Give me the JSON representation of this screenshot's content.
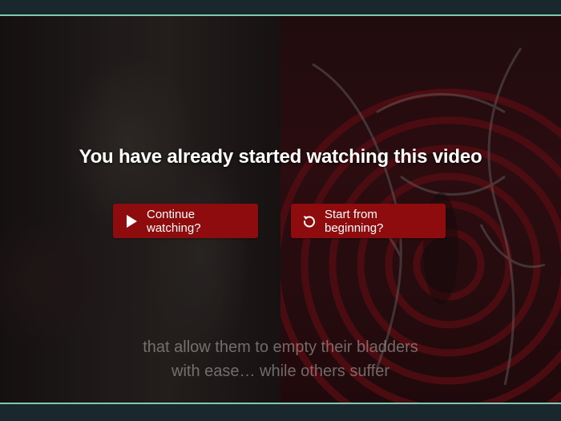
{
  "overlay": {
    "title": "You have already started watching this video"
  },
  "buttons": {
    "continue_label": "Continue watching?",
    "continue_icon": "play-icon",
    "restart_label": "Start from beginning?",
    "restart_icon": "restart-icon"
  },
  "captions": {
    "line1": "that allow them to empty their bladders",
    "line2": "with ease… while others suffer"
  },
  "colors": {
    "button_bg": "#8e0c0d",
    "accent_rule": "#7fc9b0",
    "page_bg": "#19282d"
  }
}
